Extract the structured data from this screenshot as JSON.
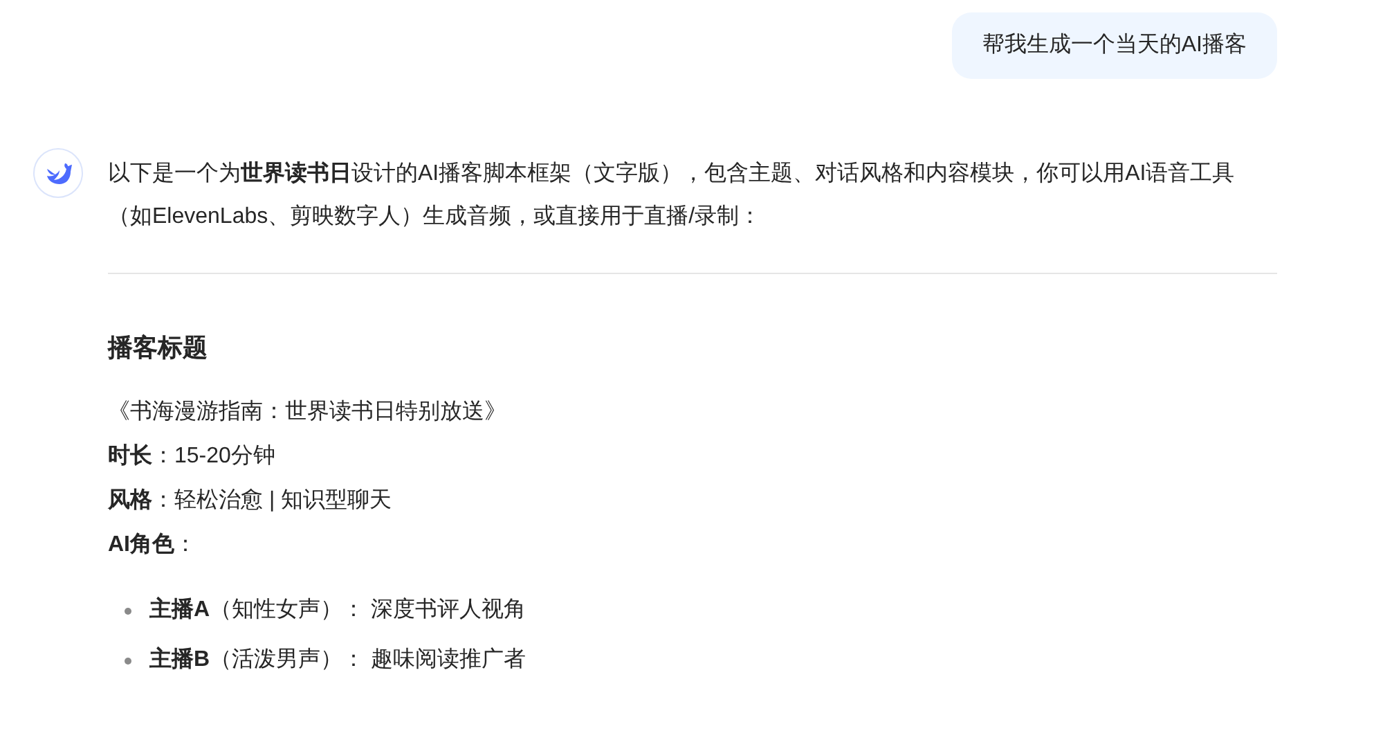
{
  "user_message": "帮我生成一个当天的AI播客",
  "assistant_message": {
    "intro": "以下是一个为**世界读书日**设计的AI播客脚本框架（文字版），包含主题、对话风格和内容模块，你可以用AI语音工具（如ElevenLabs、剪映数字人）生成音频，或直接用于直播/录制：",
    "section_heading": "播客标题",
    "lines": [
      "《书海漫游指南：世界读书日特别放送》",
      "**时长**：15-20分钟",
      "**风格**：轻松治愈 | 知识型聊天",
      "**AI角色**："
    ],
    "bullets": [
      "**主播A**（知性女声）： 深度书评人视角",
      "**主播B**（活泼男声）： 趣味阅读推广者"
    ]
  }
}
